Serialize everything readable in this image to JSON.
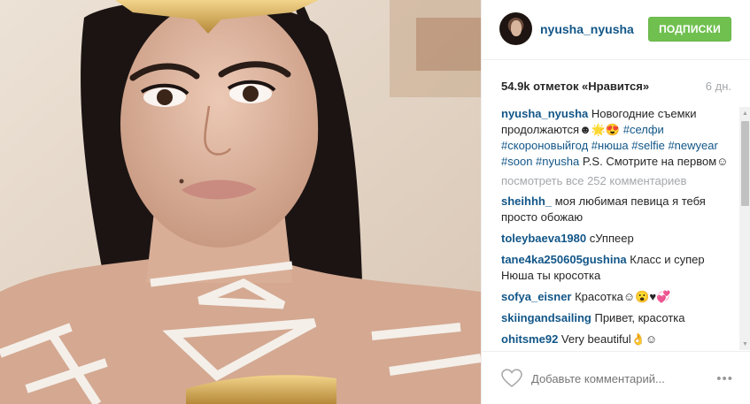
{
  "post": {
    "image_alt": "selfie photo"
  },
  "header": {
    "username": "nyusha_nyusha",
    "follow_label": "ПОДПИСКИ"
  },
  "stats": {
    "likes": "54.9k отметок «Нравится»",
    "age": "6 дн."
  },
  "caption": {
    "user": "nyusha_nyusha",
    "text_before": " Новогодние съемки продолжаются☻🌟😍 ",
    "tags1": [
      "#селфи",
      "#скороновыйгод",
      "#нюша",
      "#selfie",
      "#newyear",
      "#soon",
      "#nyusha"
    ],
    "text_after": " P.S. Смотрите на первом☺"
  },
  "view_all": "посмотреть все 252 комментариев",
  "comments": [
    {
      "user": "sheihhh_",
      "text": " моя любимая певица я тебя просто обожаю"
    },
    {
      "user": "toleybaeva1980",
      "text": " сУппеер"
    },
    {
      "user": "tane4ka250605gushina",
      "text": " Класс и супер Нюша ты кросотка"
    },
    {
      "user": "sofya_eisner",
      "text": " Красотка☺😮♥💞"
    },
    {
      "user": "skiingandsailing",
      "text": " Привет, красотка"
    },
    {
      "user": "ohitsme92",
      "text": " Very beautiful👌☺"
    }
  ],
  "footer": {
    "add_comment_placeholder": "Добавьте комментарий...",
    "more_label": "•••",
    "icons": {
      "like": "heart-outline-icon",
      "more": "more-options-icon"
    }
  },
  "colors": {
    "link": "#125688",
    "follow_bg": "#70c050",
    "muted": "#a5a7aa"
  }
}
